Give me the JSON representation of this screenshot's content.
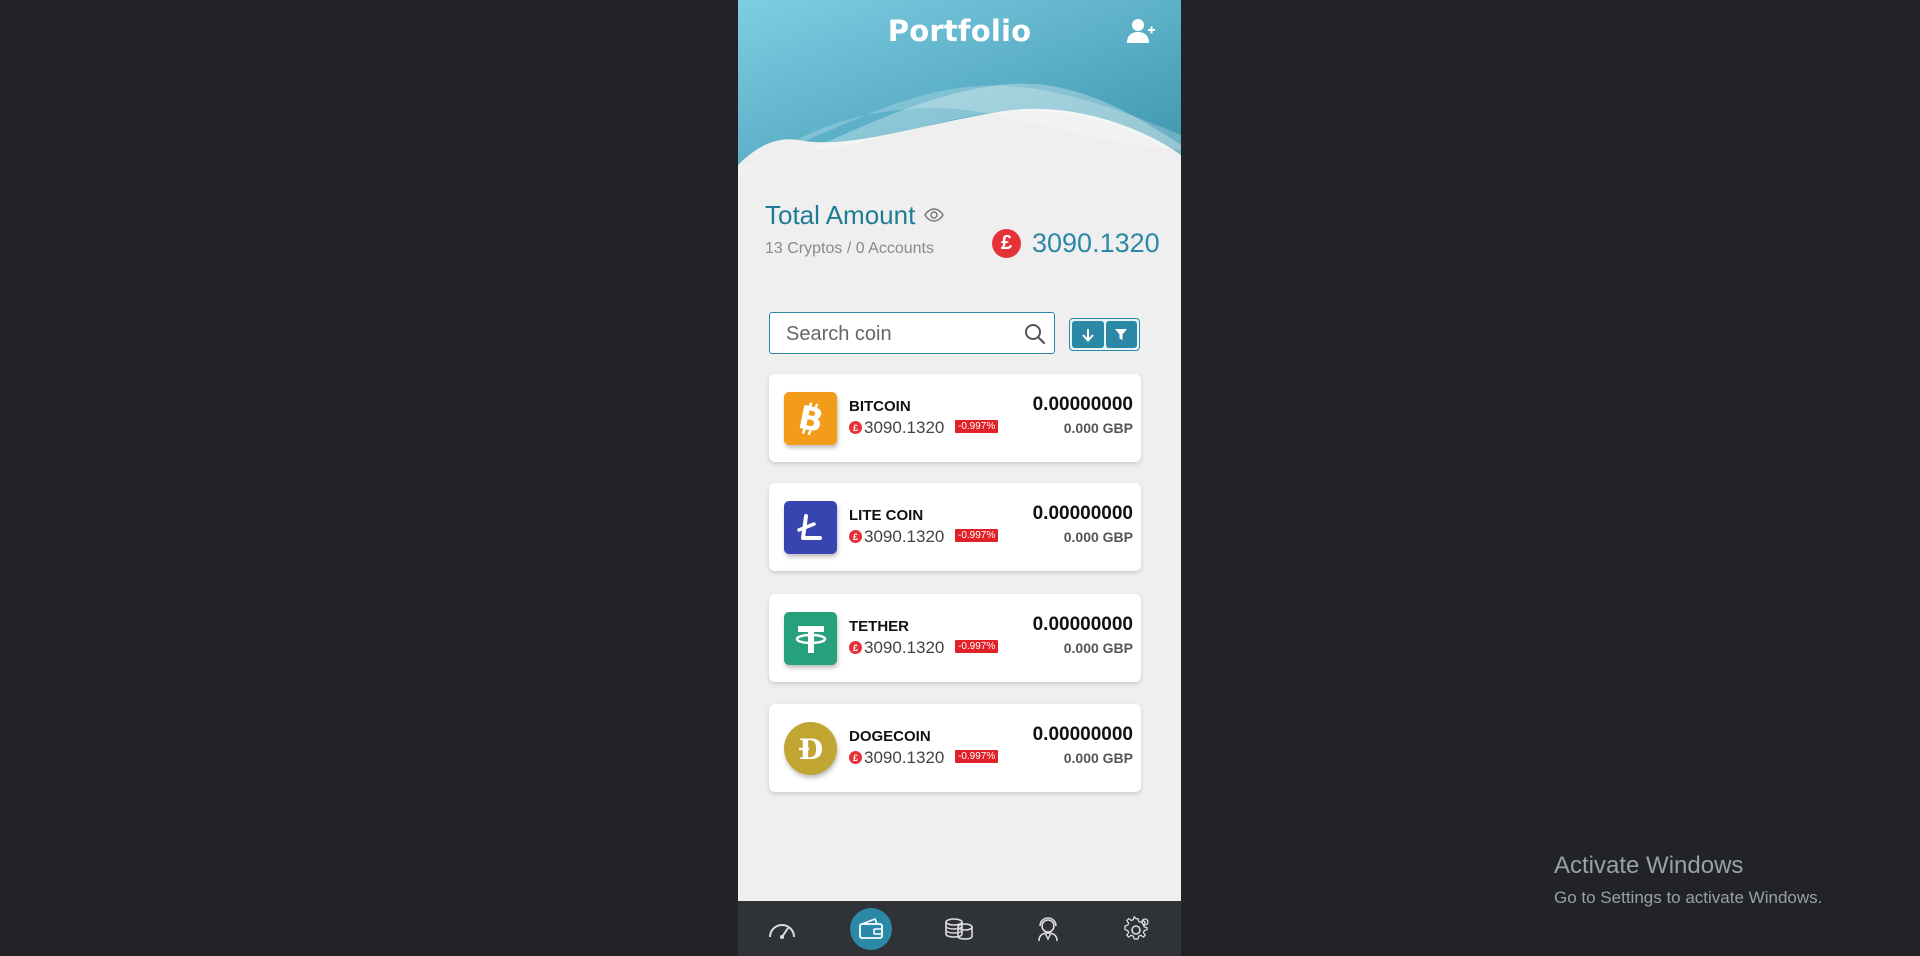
{
  "header": {
    "title": "Portfolio"
  },
  "summary": {
    "label": "Total Amount",
    "sub": "13 Cryptos / 0 Accounts",
    "currency_symbol": "£",
    "value": "3090.1320"
  },
  "search": {
    "placeholder": "Search coin"
  },
  "coins": [
    {
      "name": "BITCOIN",
      "icon": "bitcoin-icon",
      "symbol": "£",
      "price": "3090.1320",
      "change": "-0.997%",
      "amount": "0.00000000",
      "fiat": "0.000 GBP",
      "color": "#f39c1a"
    },
    {
      "name": "LITE COIN",
      "icon": "litecoin-icon",
      "symbol": "£",
      "price": "3090.1320",
      "change": "-0.997%",
      "amount": "0.00000000",
      "fiat": "0.000 GBP",
      "color": "#3845b0"
    },
    {
      "name": "TETHER",
      "icon": "tether-icon",
      "symbol": "£",
      "price": "3090.1320",
      "change": "-0.997%",
      "amount": "0.00000000",
      "fiat": "0.000 GBP",
      "color": "#26a17b"
    },
    {
      "name": "DOGECOIN",
      "icon": "dogecoin-icon",
      "symbol": "£",
      "price": "3090.1320",
      "change": "-0.997%",
      "amount": "0.00000000",
      "fiat": "0.000 GBP",
      "color": "#c2a633"
    }
  ],
  "nav": [
    {
      "icon": "speedometer-icon",
      "active": false
    },
    {
      "icon": "wallet-icon",
      "active": true
    },
    {
      "icon": "coins-stack-icon",
      "active": false
    },
    {
      "icon": "support-agent-icon",
      "active": false
    },
    {
      "icon": "gear-icon",
      "active": false
    }
  ],
  "watermark": {
    "line1": "Activate Windows",
    "line2": "Go to Settings to activate Windows."
  },
  "colors": {
    "accent": "#2b89a7",
    "negative": "#e02127",
    "header_gradient_start": "#7ecde3",
    "header_gradient_end": "#3d95ad"
  }
}
